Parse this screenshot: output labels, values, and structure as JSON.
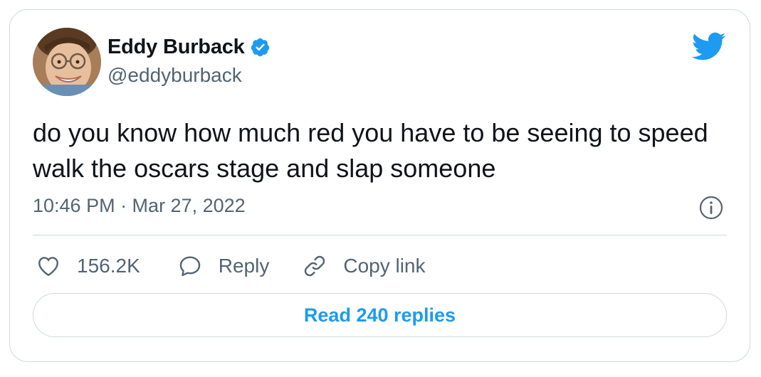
{
  "author": {
    "display_name": "Eddy Burback",
    "handle": "@eddyburback",
    "verified": true,
    "avatar": "profile-photo"
  },
  "tweet": {
    "text": "do you know how much red you have to be seeing to speed walk the oscars stage and slap someone",
    "timestamp": "10:46 PM · Mar 27, 2022"
  },
  "actions": {
    "like_count": "156.2K",
    "reply_label": "Reply",
    "copy_link_label": "Copy link"
  },
  "read_replies_label": "Read 240 replies",
  "icons": {
    "brand": "twitter-bird-icon",
    "verified": "verified-badge-icon",
    "info": "info-icon",
    "like": "heart-icon",
    "reply": "speech-bubble-icon",
    "copy_link": "link-icon"
  },
  "colors": {
    "accent": "#1d9bf0",
    "text_primary": "#0f1419",
    "text_secondary": "#536471",
    "border": "#cfd9de"
  }
}
